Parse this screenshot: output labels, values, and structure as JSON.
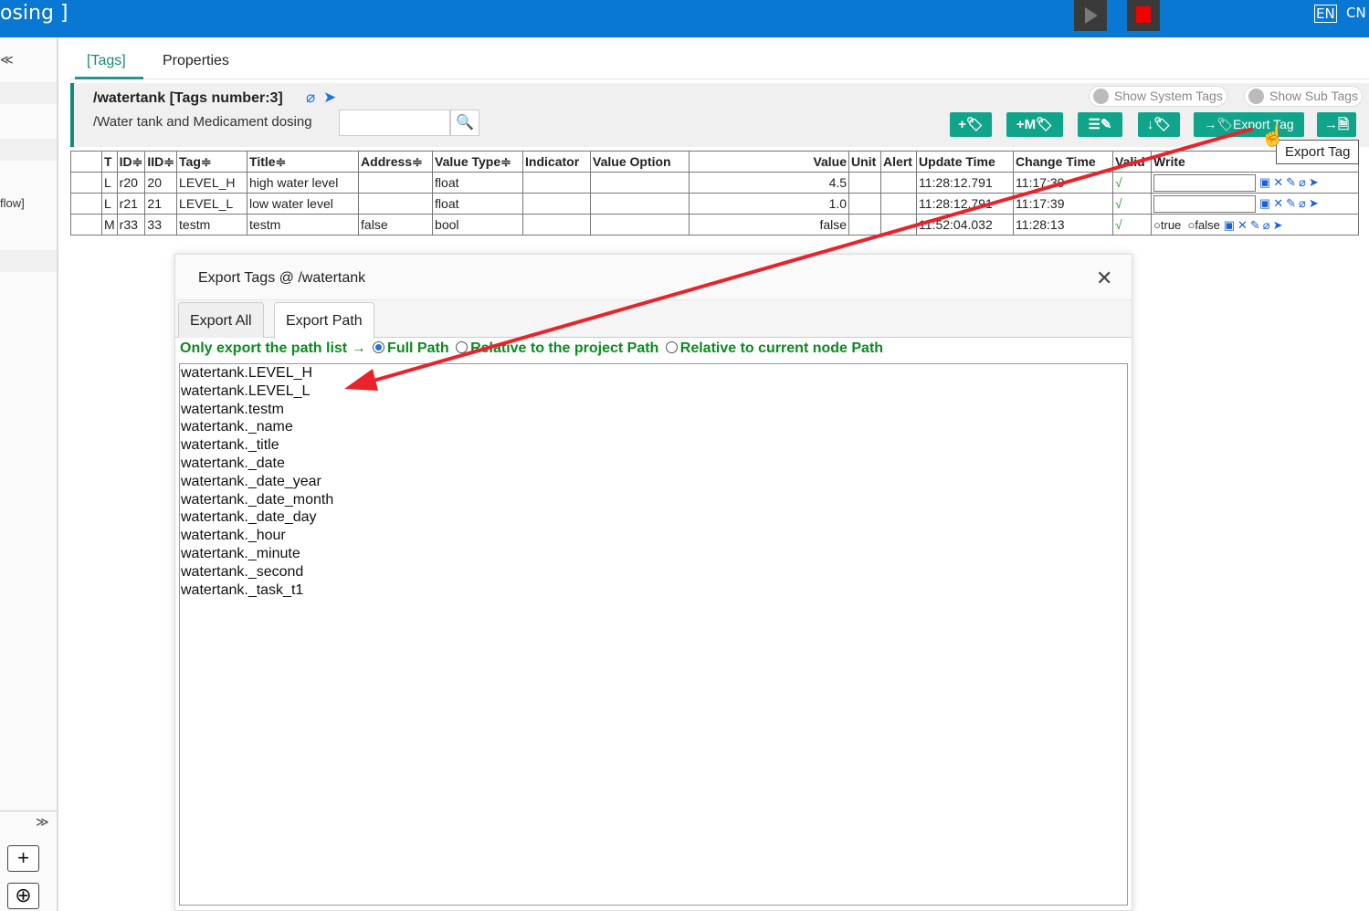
{
  "topbar": {
    "title": "osing ]",
    "lang_en": "EN",
    "lang_cn": "CN",
    "accent_color": "#0978d2"
  },
  "left_panel": {
    "collapse_top": "≪",
    "flow_item": "flow]",
    "collapse_bottom": "≫",
    "add_btn": "+",
    "nav_btn": "⊕"
  },
  "tabs": {
    "tags": "[Tags]",
    "properties": "Properties"
  },
  "header": {
    "path": "/watertank [Tags number:3]",
    "description": "/Water tank and Medicament dosing",
    "search_placeholder": "",
    "show_system_tags": "Show System Tags",
    "show_sub_tags": "Show Sub Tags",
    "btn_add_tag": "+🏷",
    "btn_add_m_tag": "+M🏷",
    "btn_batch_edit": "☰✎",
    "btn_import": "↓🏷",
    "btn_export_tag": "→🏷Export Tag",
    "btn_export_excel": "→🗎",
    "button_color": "#10a58a"
  },
  "table": {
    "headers": {
      "t": "T",
      "id": "ID≑",
      "iid": "IID≑",
      "tag": "Tag≑",
      "title": "Title≑",
      "address": "Address≑",
      "value_type": "Value Type≑",
      "indicator": "Indicator",
      "value_option": "Value Option",
      "value": "Value",
      "unit": "Unit",
      "alert": "Alert",
      "update_time": "Update Time",
      "change_time": "Change Time",
      "valid": "Valid",
      "write": "Write"
    },
    "rows": [
      {
        "t": "L",
        "id": "r20",
        "iid": "20",
        "tag": "LEVEL_H",
        "title": "high water level",
        "address": "",
        "value_type": "float",
        "indicator": "",
        "value_option": "",
        "value": "4.5",
        "unit": "",
        "alert": "",
        "update_time": "11:28:12.791",
        "change_time": "11:17:39",
        "valid": "√"
      },
      {
        "t": "L",
        "id": "r21",
        "iid": "21",
        "tag": "LEVEL_L",
        "title": "low water level",
        "address": "",
        "value_type": "float",
        "indicator": "",
        "value_option": "",
        "value": "1.0",
        "unit": "",
        "alert": "",
        "update_time": "11:28:12.791",
        "change_time": "11:17:39",
        "valid": "√"
      },
      {
        "t": "M",
        "id": "r33",
        "iid": "33",
        "tag": "testm",
        "title": "testm",
        "address": "false",
        "value_type": "bool",
        "indicator": "",
        "value_option": "",
        "value": "false",
        "unit": "",
        "alert": "",
        "update_time": "11:52:04.032",
        "change_time": "11:28:13",
        "valid": "√",
        "write_true": "true",
        "write_false": "false"
      }
    ],
    "row_icons": "▣✕✎⌀➤"
  },
  "tooltip": "Export Tag",
  "dialog": {
    "title": "Export Tags @ /watertank",
    "close": "✕",
    "tab_all": "Export All",
    "tab_path": "Export Path",
    "option_prefix": "Only export the path list",
    "opt_full": "Full Path",
    "opt_project": "Relative to the project Path",
    "opt_node": "Relative to current node Path",
    "option_color": "#0c8a20",
    "paths": [
      "watertank.LEVEL_H",
      "watertank.LEVEL_L",
      "watertank.testm",
      "watertank._name",
      "watertank._title",
      "watertank._date",
      "watertank._date_year",
      "watertank._date_month",
      "watertank._date_day",
      "watertank._hour",
      "watertank._minute",
      "watertank._second",
      "watertank._task_t1"
    ]
  },
  "annotation_color": "#e8232a"
}
